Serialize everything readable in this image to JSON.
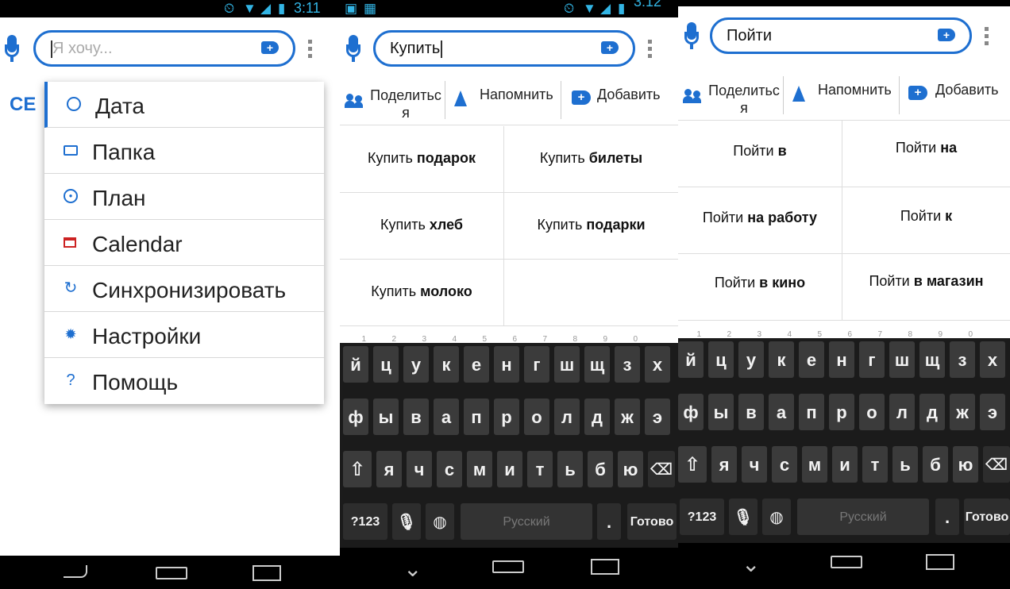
{
  "status": {
    "time_left": "3:11",
    "time_middle": "3:12"
  },
  "panel1": {
    "search_placeholder": "Я хочу...",
    "behind_text": "СЕ",
    "menu": [
      {
        "label": "Дата",
        "icon": "clock-icon"
      },
      {
        "label": "Папка",
        "icon": "folder-icon"
      },
      {
        "label": "План",
        "icon": "target-icon"
      },
      {
        "label": "Calendar",
        "icon": "calendar-icon"
      },
      {
        "label": "Синхронизировать",
        "icon": "sync-icon"
      },
      {
        "label": "Настройки",
        "icon": "gear-icon"
      },
      {
        "label": "Помощь",
        "icon": "help-icon"
      }
    ]
  },
  "panel2": {
    "search_value": "Купить",
    "actions": {
      "share_line1": "Поделитьс",
      "share_line2": "я",
      "remind": "Напомнить",
      "add": "Добавить"
    },
    "suggestions": [
      {
        "verb": "Купить",
        "obj": "подарок"
      },
      {
        "verb": "Купить",
        "obj": "билеты"
      },
      {
        "verb": "Купить",
        "obj": "хлеб"
      },
      {
        "verb": "Купить",
        "obj": "подарки"
      },
      {
        "verb": "Купить",
        "obj": "молоко"
      }
    ]
  },
  "panel3": {
    "search_value": "Пойти",
    "actions": {
      "share_line1": "Поделитьс",
      "share_line2": "я",
      "remind": "Напомнить",
      "add": "Добавить"
    },
    "suggestions": [
      {
        "verb": "Пойти",
        "obj": "в"
      },
      {
        "verb": "Пойти",
        "obj": "на"
      },
      {
        "verb": "Пойти",
        "obj": "на работу"
      },
      {
        "verb": "Пойти",
        "obj": "к"
      },
      {
        "verb": "Пойти",
        "obj": "в кино"
      },
      {
        "verb": "Пойти",
        "obj": "в магазин"
      }
    ]
  },
  "keyboard": {
    "row1": [
      "й",
      "ц",
      "у",
      "к",
      "е",
      "н",
      "г",
      "ш",
      "щ",
      "з",
      "х"
    ],
    "row1_nums": [
      "1",
      "2",
      "3",
      "4",
      "5",
      "6",
      "7",
      "8",
      "9",
      "0",
      ""
    ],
    "row2": [
      "ф",
      "ы",
      "в",
      "а",
      "п",
      "р",
      "о",
      "л",
      "д",
      "ж",
      "э"
    ],
    "row3": [
      "я",
      "ч",
      "с",
      "м",
      "и",
      "т",
      "ь",
      "б",
      "ю"
    ],
    "symbols": "?123",
    "space": "Русский",
    "period": ".",
    "done": "Готово"
  }
}
